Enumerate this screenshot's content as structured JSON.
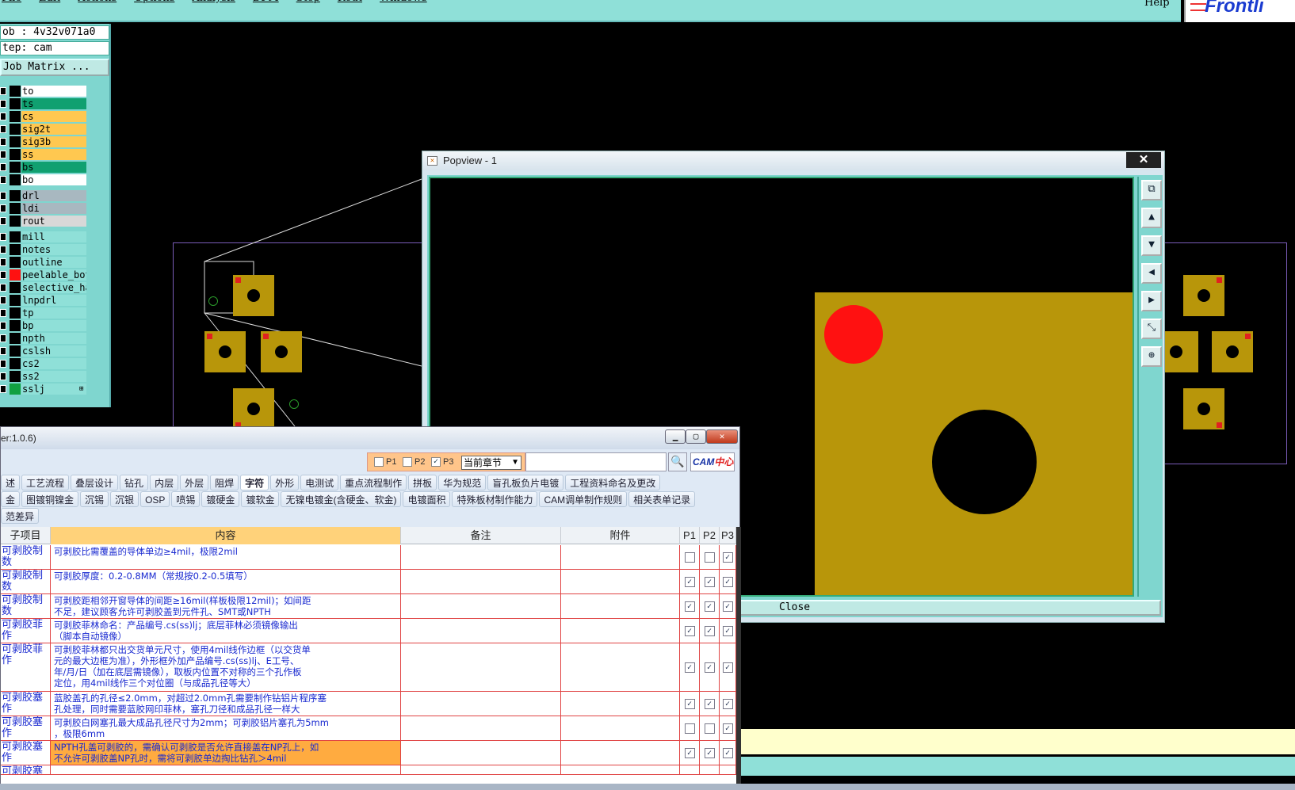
{
  "menu": [
    "File",
    "Edit",
    "Actions",
    "Options",
    "Analysis",
    "DFM",
    "Step",
    "Rout",
    "Windows"
  ],
  "menu_help": "Help",
  "logo_text": "Frontli",
  "job_label": "ob : 4v32v071a0",
  "step_label": "tep: cam",
  "job_matrix": "Job Matrix ...",
  "layers": [
    {
      "name": "to",
      "color": "#ffffff",
      "sw": "#000000"
    },
    {
      "name": "ts",
      "color": "#10a070",
      "sw": "#000000"
    },
    {
      "name": "cs",
      "color": "#ffc850",
      "sw": "#000000"
    },
    {
      "name": "sig2t",
      "color": "#ffc850",
      "sw": "#000000"
    },
    {
      "name": "sig3b",
      "color": "#ffc850",
      "sw": "#000000"
    },
    {
      "name": "ss",
      "color": "#ffc850",
      "sw": "#000000"
    },
    {
      "name": "bs",
      "color": "#10a070",
      "sw": "#000000"
    },
    {
      "name": "bo",
      "color": "#ffffff",
      "sw": "#000000"
    },
    {
      "name": "drl",
      "color": "#a8b8c0",
      "sw": "#000000"
    },
    {
      "name": "ldi",
      "color": "#a8b8c0",
      "sw": "#000000"
    },
    {
      "name": "rout",
      "color": "#d8d8d8",
      "sw": "#000000"
    },
    {
      "name": "mill",
      "color": "#8fe0d8",
      "sw": "#000000"
    },
    {
      "name": "notes",
      "color": "#8fe0d8",
      "sw": "#000000"
    },
    {
      "name": "outline",
      "color": "#8fe0d8",
      "sw": "#000000"
    },
    {
      "name": "peelable_bot",
      "color": "#8fe0d8",
      "sw": "#ff1111"
    },
    {
      "name": "selective_ha",
      "color": "#8fe0d8",
      "sw": "#000000"
    },
    {
      "name": "lnpdrl",
      "color": "#8fe0d8",
      "sw": "#000000"
    },
    {
      "name": "tp",
      "color": "#8fe0d8",
      "sw": "#000000"
    },
    {
      "name": "bp",
      "color": "#8fe0d8",
      "sw": "#000000"
    },
    {
      "name": "npth",
      "color": "#8fe0d8",
      "sw": "#000000"
    },
    {
      "name": "cslsh",
      "color": "#8fe0d8",
      "sw": "#000000"
    },
    {
      "name": "cs2",
      "color": "#8fe0d8",
      "sw": "#000000"
    },
    {
      "name": "ss2",
      "color": "#8fe0d8",
      "sw": "#000000"
    },
    {
      "name": "sslj",
      "color": "#8fe0d8",
      "sw": "#10a040"
    }
  ],
  "popview": {
    "title": "Popview - 1",
    "close_label": "Close"
  },
  "toolwin": {
    "title": "er:1.0.6)",
    "filters": [
      {
        "label": "P1",
        "checked": false
      },
      {
        "label": "P2",
        "checked": false
      },
      {
        "label": "P3",
        "checked": true
      }
    ],
    "section_select": "当前章节",
    "cam_logo": "CAM",
    "cam_logo_red": "中心",
    "tabs_row1": [
      "述",
      "工艺流程",
      "叠层设计",
      "钻孔",
      "内层",
      "外层",
      "阻焊",
      "字符",
      "外形",
      "电测试",
      "重点流程制作",
      "拼板",
      "华为规范",
      "盲孔板负片电镀",
      "工程资料命名及更改"
    ],
    "active_tab": "字符",
    "tabs_row2": [
      "金",
      "图镀铜镍金",
      "沉锡",
      "沉银",
      "OSP",
      "喷锡",
      "镀硬金",
      "镀软金",
      "无镍电镀金(含硬金、软金)",
      "电镀面积",
      "特殊板材制作能力",
      "CAM调单制作规则",
      "相关表单记录"
    ],
    "tabs_row3": [
      "范差异"
    ],
    "columns": [
      "子项目",
      "内容",
      "备注",
      "附件",
      "P1",
      "P2",
      "P3"
    ],
    "rows": [
      {
        "cat": "可剥胶制\n数",
        "content": "可剥胶比需覆盖的导体单边≥4mil，极限2mil",
        "p": [
          false,
          false,
          true
        ],
        "h": 31
      },
      {
        "cat": "可剥胶制\n数",
        "content": "可剥胶厚度：0.2-0.8MM（常规按0.2-0.5填写）",
        "p": [
          true,
          true,
          true
        ],
        "h": 31
      },
      {
        "cat": "可剥胶制\n数",
        "content": "可剥胶距相邻开窗导体的间距≥16mil(样板极限12mil)；如间距\n不足，建议顾客允许可剥胶盖到元件孔、SMT或NPTH",
        "p": [
          true,
          true,
          true
        ],
        "h": 31
      },
      {
        "cat": "可剥胶菲\n作",
        "content": "可剥胶菲林命名：产品编号.cs(ss)lj；底层菲林必须镜像输出\n（脚本自动镜像）",
        "p": [
          true,
          true,
          true
        ],
        "h": 31
      },
      {
        "cat": "可剥胶菲\n作",
        "content": "可剥胶菲林都只出交货单元尺寸，使用4mil线作边框（以交货单\n元的最大边框为准），外形框外加产品编号.cs(ss)lj、E工号、\n年/月/日（加在底层需镜像），取板内位置不对称的三个孔作板\n定位，用4mil线作三个对位圈（与成品孔径等大）",
        "p": [
          true,
          true,
          true
        ],
        "h": 61
      },
      {
        "cat": "可剥胶塞\n作",
        "content": "蓝胶盖孔的孔径≤2.0mm，对超过2.0mm孔需要制作钻铝片程序塞\n孔处理，同时需要蓝胶网印菲林，塞孔刀径和成品孔径一样大",
        "p": [
          true,
          true,
          true
        ],
        "h": 31
      },
      {
        "cat": "可剥胶塞\n作",
        "content": "可剥胶白网塞孔最大成品孔径尺寸为2mm；可剥胶铝片塞孔为5mm\n，极限6mm",
        "p": [
          false,
          false,
          true
        ],
        "h": 31
      },
      {
        "cat": "可剥胶塞\n作",
        "content": "NPTH孔盖可剥胶的，需确认可剥胶是否允许直接盖在NP孔上，如\n不允许可剥胶盖NP孔时，需将可剥胶单边掏比钻孔＞4mil",
        "p": [
          true,
          true,
          true
        ],
        "h": 31,
        "hl": true
      },
      {
        "cat": "可剥胶塞",
        "content": "",
        "p": [
          false,
          false,
          false
        ],
        "h": 12
      }
    ]
  }
}
